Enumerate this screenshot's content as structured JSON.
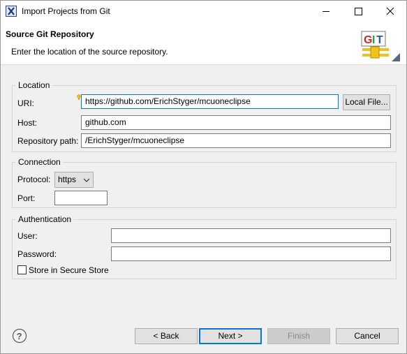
{
  "window": {
    "title": "Import Projects from Git",
    "icon": "eclipse-x-icon"
  },
  "header": {
    "title": "Source Git Repository",
    "description": "Enter the location of the source repository.",
    "logo_text": "GIT"
  },
  "location": {
    "group_label": "Location",
    "uri_label": "URI:",
    "uri_value": "https://github.com/ErichStyger/mcuoneclipse",
    "local_file_button": "Local File...",
    "host_label": "Host:",
    "host_value": "github.com",
    "repo_path_label": "Repository path:",
    "repo_path_value": "/ErichStyger/mcuoneclipse"
  },
  "connection": {
    "group_label": "Connection",
    "protocol_label": "Protocol:",
    "protocol_value": "https",
    "port_label": "Port:",
    "port_value": ""
  },
  "authentication": {
    "group_label": "Authentication",
    "user_label": "User:",
    "user_value": "",
    "password_label": "Password:",
    "password_value": "",
    "store_label": "Store in Secure Store",
    "store_checked": false
  },
  "footer": {
    "back": "< Back",
    "next": "Next >",
    "finish": "Finish",
    "cancel": "Cancel"
  },
  "colors": {
    "accent": "#0078d7",
    "git_red": "#cc2a2a",
    "git_green": "#2e9a3a",
    "git_yellow": "#f2c21b"
  }
}
